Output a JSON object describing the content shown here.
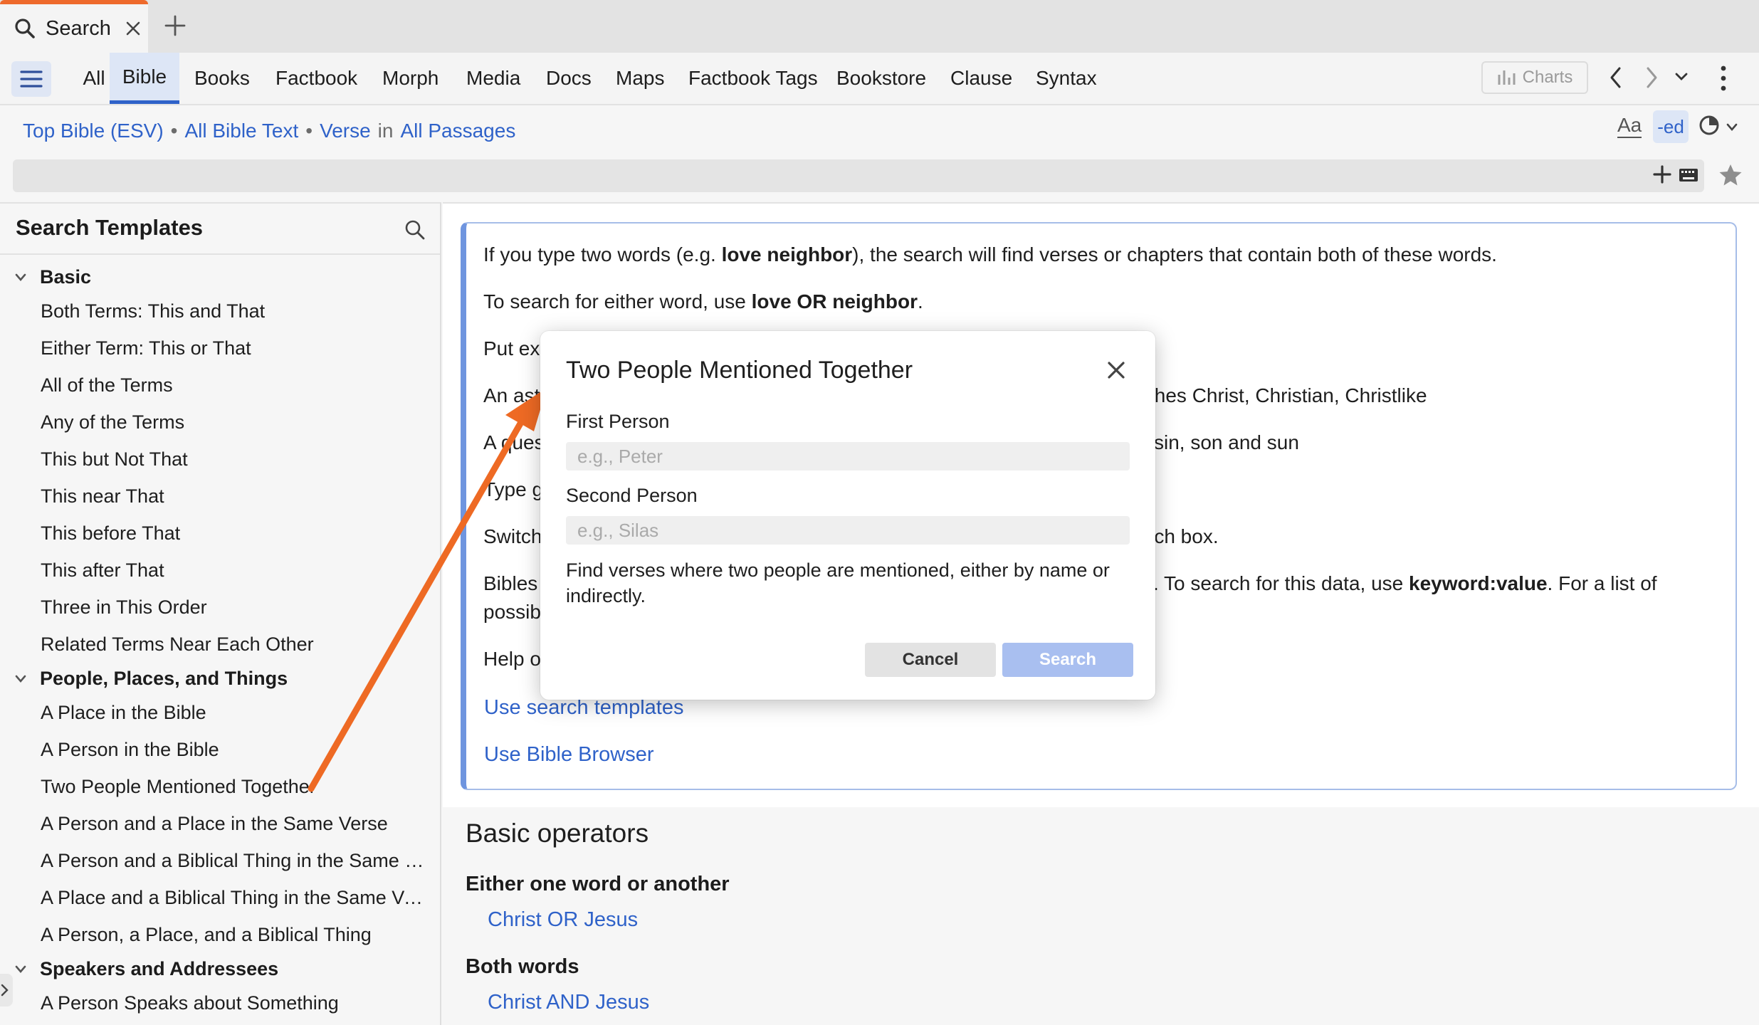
{
  "tab": {
    "label": "Search"
  },
  "nav": {
    "tabs": [
      "All",
      "Bible",
      "Books",
      "Factbook",
      "Morph",
      "Media",
      "Docs",
      "Maps",
      "Factbook Tags",
      "Bookstore",
      "Clause",
      "Syntax"
    ],
    "active": "Bible",
    "charts_label": "Charts"
  },
  "scope": {
    "bible": "Top Bible (ESV)",
    "text": "All Bible Text",
    "unit": "Verse",
    "in": "in",
    "range": "All Passages"
  },
  "tools": {
    "font_label": "Aa",
    "ed_label": "-ed"
  },
  "sidebar": {
    "title": "Search Templates",
    "groups": [
      {
        "label": "Basic",
        "items": [
          "Both Terms: This and That",
          "Either Term: This or That",
          "All of the Terms",
          "Any of the Terms",
          "This but Not That",
          "This near That",
          "This before That",
          "This after That",
          "Three in This Order",
          "Related Terms Near Each Other"
        ]
      },
      {
        "label": "People, Places, and Things",
        "items": [
          "A Place in the Bible",
          "A Person in the Bible",
          "Two People Mentioned Together",
          "A Person and a Place in the Same Verse",
          "A Person and a Biblical Thing in the Same Ve…",
          "A Place and a Biblical Thing in the Same Verse",
          "A Person, a Place, and a Biblical Thing"
        ]
      },
      {
        "label": "Speakers and Addressees",
        "items": [
          "A Person Speaks about Something"
        ]
      }
    ]
  },
  "help": {
    "l1a": "If you type two words (e.g. ",
    "l1b": "love neighbor",
    "l1c": "), the search will find verses or chapters that contain both of these words.",
    "l2a": "To search for either word, use ",
    "l2b": "love OR neighbor",
    "l2c": ".",
    "l3": "Put ex",
    "l4a": "An ast",
    "l4b": "tches Christ, Christian, Christlike",
    "l5a": "A ques",
    "l5b": "sin, son and sun",
    "l6": "Type g",
    "l7a": "Switch",
    "l7b": "rch box.",
    "l8a": "Bibles",
    "l8b": ". To search for this data, use ",
    "l8c": "keyword:value",
    "l8d": ". For a list of",
    "l9": "possib",
    "l10": "Help o",
    "link1": "Use search templates",
    "link2": "Use Bible Browser"
  },
  "operators": {
    "title": "Basic operators",
    "h1": "Either one word or another",
    "ex1": "Christ OR Jesus",
    "h2": "Both words",
    "ex2": "Christ AND Jesus"
  },
  "dialog": {
    "title": "Two People Mentioned Together",
    "first_label": "First Person",
    "first_placeholder": "e.g., Peter",
    "second_label": "Second Person",
    "second_placeholder": "e.g., Silas",
    "description": "Find verses where two people are mentioned, either by name or indirectly.",
    "cancel": "Cancel",
    "search": "Search"
  },
  "colors": {
    "accent": "#2f62c9",
    "tab_highlight": "#ee6a2c",
    "arrow": "#ee6a24"
  }
}
